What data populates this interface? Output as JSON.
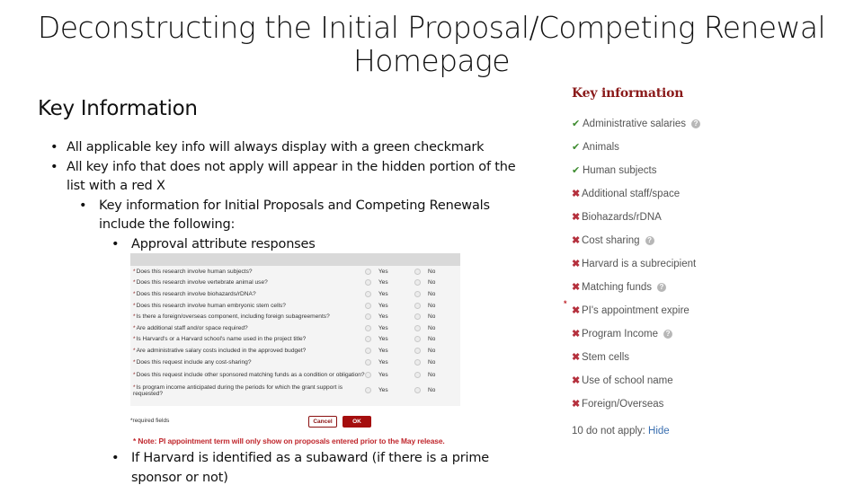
{
  "slide": {
    "title_line1": "Deconstructing the Initial Proposal/Competing Renewal",
    "title_line2": "Homepage",
    "section_heading": "Key Information"
  },
  "bullets": [
    {
      "level": 1,
      "text": "All applicable key info will always display with a green checkmark"
    },
    {
      "level": 1,
      "text": "All key info that does not apply will appear in the hidden portion of the list with a red X"
    },
    {
      "level": 2,
      "text": "Key information for Initial Proposals and Competing Renewals include the following:"
    },
    {
      "level": 3,
      "text": "Approval attribute responses"
    }
  ],
  "bullet_glyph": "•",
  "form": {
    "required_marker": "*",
    "yes_label": "Yes",
    "no_label": "No",
    "questions": [
      "Does this research involve human subjects?",
      "Does this research involve vertebrate animal use?",
      "Does this research involve biohazards/rDNA?",
      "Does this research involve human embryonic stem cells?",
      "Is there a foreign/overseas component, including foreign subagreements?",
      "Are additional staff and/or space required?",
      "Is Harvard's or a Harvard school's name used in the project title?",
      "Are administrative salary costs included in the approved budget?",
      "Does this request include any cost-sharing?",
      "Does this request include other sponsored matching funds as a condition or obligation?",
      "Is program income anticipated during the periods for which the grant support is requested?"
    ],
    "required_fields_note": "*required fields",
    "cancel_label": "Cancel",
    "ok_label": "OK"
  },
  "pi_note": "* Note: PI appointment term will only show on proposals entered prior to the May release.",
  "bottom_bullet": "If Harvard is identified as a subaward (if there is a prime sponsor or not)",
  "key_info_panel": {
    "title": "Key information",
    "check_glyph": "✔",
    "x_glyph": "✖",
    "help_glyph": "?",
    "arrow_marker": "*",
    "items": [
      {
        "label": "Administrative salaries",
        "status": "applies",
        "help": true
      },
      {
        "label": "Animals",
        "status": "applies",
        "help": false
      },
      {
        "label": "Human subjects",
        "status": "applies",
        "help": false
      },
      {
        "label": "Additional staff/space",
        "status": "not-applies",
        "help": false
      },
      {
        "label": "Biohazards/rDNA",
        "status": "not-applies",
        "help": false
      },
      {
        "label": "Cost sharing",
        "status": "not-applies",
        "help": true
      },
      {
        "label": "Harvard is a subrecipient",
        "status": "not-applies",
        "help": false
      },
      {
        "label": "Matching funds",
        "status": "not-applies",
        "help": true
      },
      {
        "label": "PI's appointment expire",
        "status": "not-applies",
        "help": false,
        "marked": true
      },
      {
        "label": "Program Income",
        "status": "not-applies",
        "help": true
      },
      {
        "label": "Stem cells",
        "status": "not-applies",
        "help": false
      },
      {
        "label": "Use of school name",
        "status": "not-applies",
        "help": false
      },
      {
        "label": "Foreign/Overseas",
        "status": "not-applies",
        "help": false
      }
    ],
    "footer_text": "10 do not apply: ",
    "hide_link": "Hide"
  },
  "colors": {
    "check_green": "#3d8b2f",
    "x_red": "#b5303d",
    "title_maroon": "#8a1a1a",
    "ok_button": "#a50e0e",
    "note_red": "#c0272d",
    "link_blue": "#3a6fb0"
  }
}
